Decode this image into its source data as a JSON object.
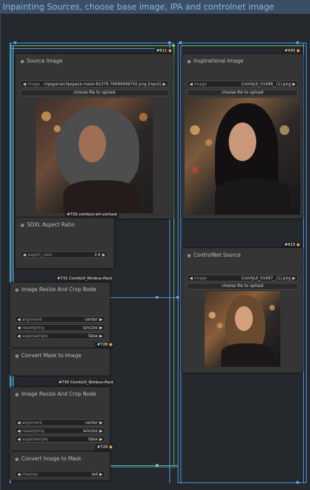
{
  "group": {
    "title": "Inpainting Sources, choose base image, IPA and controlnet image"
  },
  "source_image": {
    "title": "Source Image",
    "image_label": "image",
    "image_value": "clipspace/clipspace-mask-82379.79999999702.png [input]",
    "upload_label": "choose file to upload",
    "caption": "#733 comfyui-art-venture"
  },
  "inspirational_image": {
    "title": "Inspirational Image",
    "image_label": "image",
    "image_value": "ComfyUI_01498_ (1).png",
    "upload_label": "choose file to upload"
  },
  "badges": {
    "b611": "#611",
    "b430": "#430",
    "b413": "#413",
    "b731": "#731 ComfyUI_Nimbus-Pack",
    "b728": "#728",
    "b730": "#730 ComfyUI_Nimbus-Pack",
    "b729": "#729"
  },
  "sdxl_aspect": {
    "title": "SDXL Aspect Ratio",
    "label": "aspect_ratio",
    "value": "3:4"
  },
  "controlnet_source": {
    "title": "ControlNet Source",
    "image_label": "image",
    "image_value": "ComfyUI_01497_ (1).png",
    "upload_label": "choose file to upload"
  },
  "resize_crop_1": {
    "title": "Image Resize And Crop Node",
    "rows": [
      {
        "label": "alignment",
        "value": "center"
      },
      {
        "label": "resampling",
        "value": "lanczos"
      },
      {
        "label": "supersample",
        "value": "false"
      }
    ]
  },
  "convert_mask": {
    "title": "Convert Mask to Image"
  },
  "resize_crop_2": {
    "title": "Image Resize And Crop Node",
    "rows": [
      {
        "label": "alignment",
        "value": "center"
      },
      {
        "label": "resampling",
        "value": "lanczos"
      },
      {
        "label": "supersample",
        "value": "false"
      }
    ]
  },
  "convert_image": {
    "title": "Convert Image to Mask",
    "label": "channel",
    "value": "red"
  },
  "colors": {
    "wire_blue": "#4c9be8",
    "wire_green": "#66c07a",
    "group_header": "#3a4f66"
  }
}
